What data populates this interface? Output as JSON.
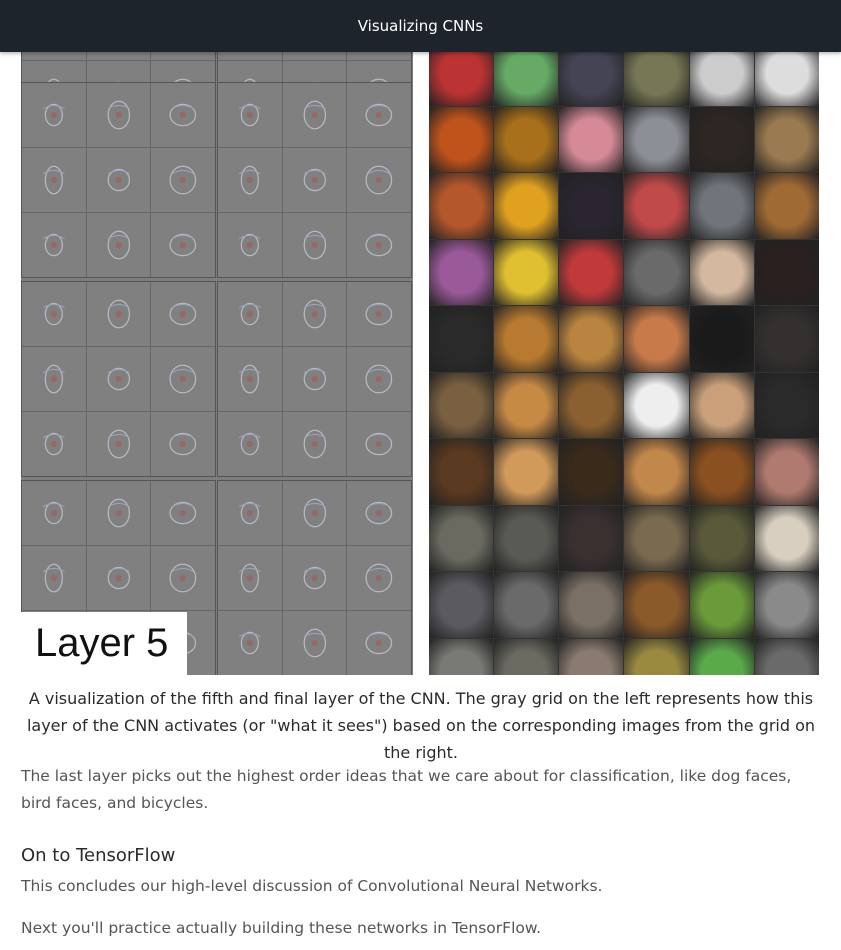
{
  "topbar": {
    "title": "Visualizing CNNs"
  },
  "figure": {
    "label": "Layer 5",
    "photo_colors": [
      "#b33",
      "#6a6",
      "#445",
      "#775",
      "#ccc",
      "#ddd",
      "#c0531b",
      "#a8701a",
      "#d68a97",
      "#8c9096",
      "#2d2622",
      "#9a7a50",
      "#b4572a",
      "#e0a020",
      "#2a2530",
      "#c04a4a",
      "#70757b",
      "#a06a35",
      "#9a5a9a",
      "#e0c030",
      "#c03a3a",
      "#6a6a6a",
      "#d4b8a0",
      "#2a2020",
      "#2a2a2a",
      "#b77a30",
      "#b9843f",
      "#c77a4a",
      "#1a1a1a",
      "#353030",
      "#7a6040",
      "#c68a45",
      "#8a6030",
      "#eeeeee",
      "#c9a07a",
      "#2a2a2a",
      "#5a3a20",
      "#d29a5a",
      "#3a2a1a",
      "#c2874a",
      "#8a5020",
      "#b07a70",
      "#6a6a60",
      "#5a5a55",
      "#3a3030",
      "#7a6a50",
      "#5a5a3a",
      "#d8cfc0",
      "#5a5a60",
      "#6a6a6a",
      "#7a7065",
      "#8a5a2a",
      "#6a9a3a",
      "#8a8a8a",
      "#7a7a75",
      "#6a6a60",
      "#8a7a70",
      "#9a8a40",
      "#5aaa4a",
      "#6a6a6a"
    ]
  },
  "caption": "A visualization of the fifth and final layer of the CNN. The gray grid on the left represents how this layer of the CNN activates (or \"what it sees\") based on the corresponding images from the grid on the right.",
  "paragraph1": "The last layer picks out the highest order ideas that we care about for classification, like dog faces, bird faces, and bicycles.",
  "section": {
    "heading": "On to TensorFlow",
    "p1": "This concludes our high-level discussion of Convolutional Neural Networks.",
    "p2": "Next you'll practice actually building these networks in TensorFlow."
  }
}
